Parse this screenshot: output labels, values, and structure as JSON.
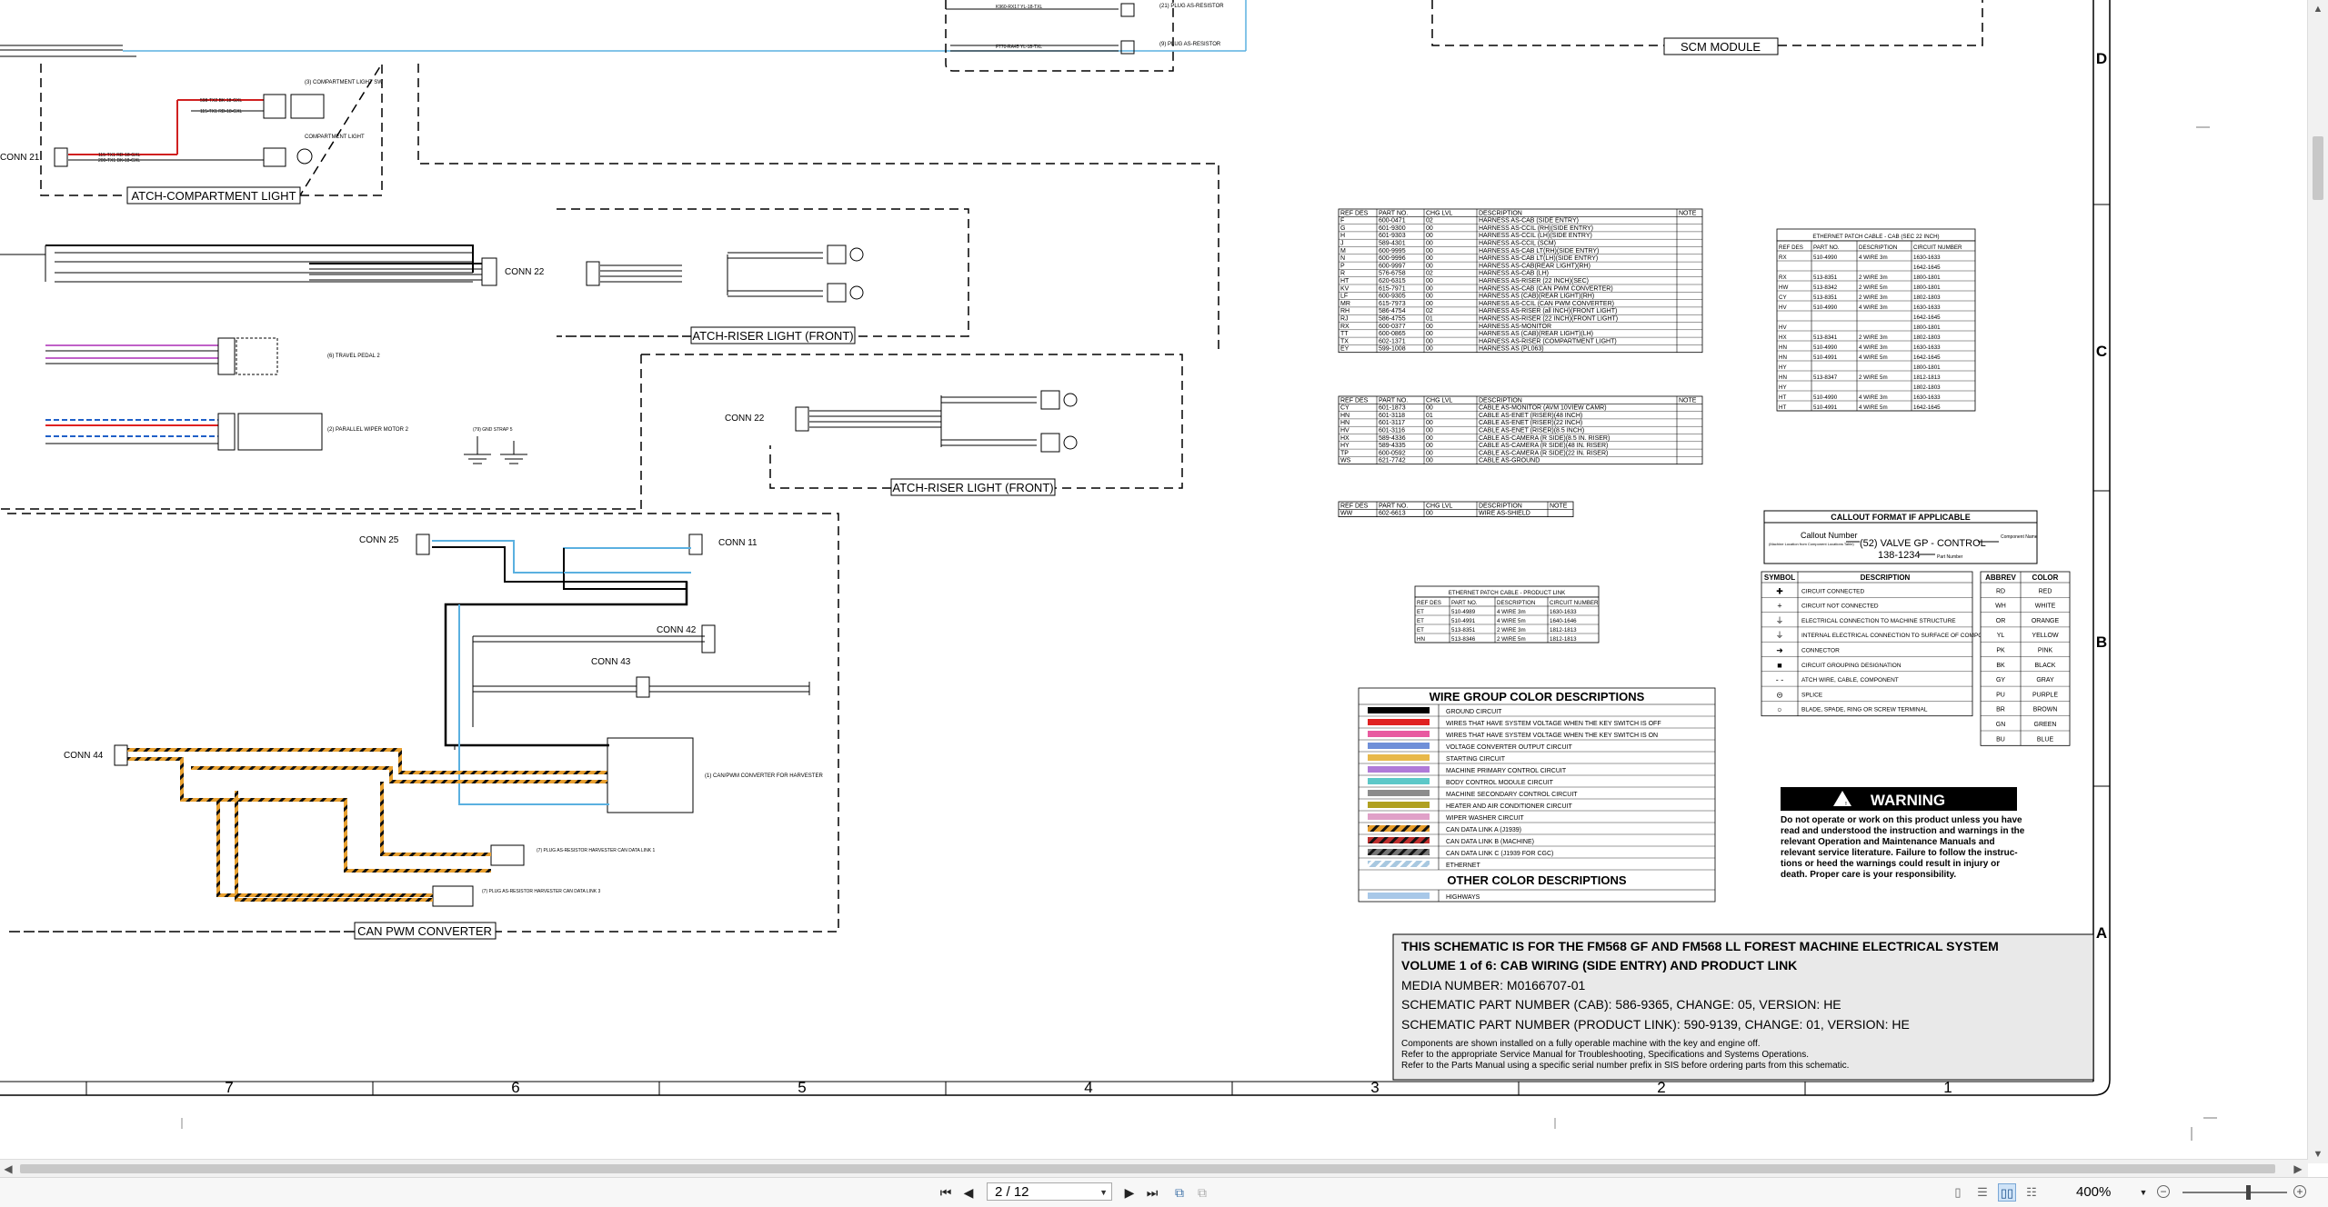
{
  "titleblock": {
    "line1": "THIS SCHEMATIC IS FOR THE FM568 GF AND FM568 LL FOREST MACHINE ELECTRICAL SYSTEM",
    "line2": "VOLUME 1 of 6: CAB WIRING (SIDE ENTRY) AND PRODUCT LINK",
    "line3": "MEDIA NUMBER: M0166707-01",
    "line4": "SCHEMATIC PART NUMBER (CAB): 586-9365, CHANGE: 05, VERSION: HE",
    "line5": "SCHEMATIC PART NUMBER (PRODUCT LINK): 590-9139, CHANGE: 01, VERSION: HE",
    "note1": "Components are shown installed on a fully operable machine with the key and engine off.",
    "note2": "Refer to the appropriate Service Manual for Troubleshooting, Specifications and Systems Operations.",
    "note3": "Refer to the Parts Manual using a specific serial number prefix in SIS before ordering parts from this schematic."
  },
  "modules": {
    "scm": "SCM MODULE",
    "compartment_light": "ATCH-COMPARTMENT LIGHT",
    "riser_front_1": "ATCH-RISER LIGHT (FRONT)",
    "riser_front_2": "ATCH-RISER LIGHT (FRONT)",
    "can_pwm": "CAN PWM CONVERTER"
  },
  "connectors": {
    "conn21": "CONN 21",
    "conn22a": "CONN 22",
    "conn22b": "CONN 22",
    "conn25": "CONN 25",
    "conn11": "CONN 11",
    "conn42": "CONN 42",
    "conn43": "CONN 43",
    "conn44": "CONN 44"
  },
  "components": {
    "travel_pedal": "(6) TRAVEL PEDAL 2",
    "wiper_motor": "(2) PARALLEL WIPER MOTOR 2",
    "gnd_strap": "(79) GND STRAP 5",
    "can_pwm_conv": "(1) CAN/PWM CONVERTER FOR HARVESTER",
    "resistor_1": "(7) PLUG AS-RESISTOR HARVESTER CAN DATA LINK 1",
    "resistor_2": "(7) PLUG AS-RESISTOR HARVESTER CAN DATA LINK 3",
    "compartment_sw": "(3) COMPARTMENT LIGHT SW",
    "compartment_lamp": "COMPARTMENT LIGHT"
  },
  "zones": {
    "bottom": [
      "7",
      "6",
      "5",
      "4",
      "3",
      "2",
      "1"
    ],
    "right": [
      "D",
      "C",
      "B",
      "A"
    ]
  },
  "harness_table1": {
    "headers": [
      "REF DES",
      "PART NO.",
      "CHG LVL",
      "DESCRIPTION",
      "NOTE"
    ],
    "rows": [
      [
        "F",
        "600-0471",
        "02",
        "HARNESS AS-CAB (SIDE ENTRY)",
        ""
      ],
      [
        "G",
        "601-9300",
        "00",
        "HARNESS AS-CCIL (RH)(SIDE ENTRY)",
        ""
      ],
      [
        "H",
        "601-9303",
        "00",
        "HARNESS AS-CCIL (LH)(SIDE ENTRY)",
        ""
      ],
      [
        "J",
        "589-4301",
        "00",
        "HARNESS AS-CCIL (SCM)",
        ""
      ],
      [
        "M",
        "600-9995",
        "00",
        "HARNESS AS-CAB LT(RH)(SIDE ENTRY)",
        ""
      ],
      [
        "N",
        "600-9996",
        "00",
        "HARNESS AS-CAB LT(LH)(SIDE ENTRY)",
        ""
      ],
      [
        "P",
        "600-9997",
        "00",
        "HARNESS AS-CAB(REAR LIGHT)(RH)",
        ""
      ],
      [
        "R",
        "576-6758",
        "02",
        "HARNESS AS-CAB (LH)",
        ""
      ],
      [
        "HT",
        "620-6315",
        "00",
        "HARNESS AS-RISER (22 INCH)(SEC)",
        ""
      ],
      [
        "KV",
        "615-7971",
        "00",
        "HARNESS AS-CAB (CAN PWM CONVERTER)",
        ""
      ],
      [
        "LF",
        "600-9305",
        "00",
        "HARNESS AS (CAB)(REAR LIGHT)(RH)",
        ""
      ],
      [
        "MR",
        "615-7973",
        "00",
        "HARNESS AS-CCIL (CAN PWM CONVERTER)",
        ""
      ],
      [
        "RH",
        "586-4754",
        "02",
        "HARNESS AS-RISER (all INCH)(FRONT LIGHT)",
        ""
      ],
      [
        "RJ",
        "586-4755",
        "01",
        "HARNESS AS-RISER (22 INCH)(FRONT LIGHT)",
        ""
      ],
      [
        "RX",
        "600-0377",
        "00",
        "HARNESS AS-MONITOR",
        ""
      ],
      [
        "TT",
        "600-0865",
        "00",
        "HARNESS AS (CAB)(REAR LIGHT)(LH)",
        ""
      ],
      [
        "TX",
        "602-1371",
        "00",
        "HARNESS AS-RISER (COMPARTMENT LIGHT)",
        ""
      ],
      [
        "EY",
        "599-1008",
        "00",
        "HARNESS AS (PL063)",
        ""
      ]
    ]
  },
  "harness_table2": {
    "headers": [
      "REF DES",
      "PART NO.",
      "CHG LVL",
      "DESCRIPTION",
      "NOTE"
    ],
    "rows": [
      [
        "CY",
        "601-1873",
        "00",
        "CABLE AS-MONITOR (AVM 10VIEW CAMR)",
        ""
      ],
      [
        "HN",
        "601-3118",
        "01",
        "CABLE AS-ENET (RISER)(48 INCH)",
        ""
      ],
      [
        "HN",
        "601-3117",
        "00",
        "CABLE AS-ENET (RISER)(22 INCH)",
        ""
      ],
      [
        "HV",
        "601-3116",
        "00",
        "CABLE AS-ENET (RISER)(8.5 INCH)",
        ""
      ],
      [
        "HX",
        "589-4336",
        "00",
        "CABLE AS-CAMERA (R SIDE)(8.5 IN. RISER)",
        ""
      ],
      [
        "HY",
        "589-4335",
        "00",
        "CABLE AS-CAMERA (R SIDE)(48 IN. RISER)",
        ""
      ],
      [
        "TP",
        "600-0592",
        "00",
        "CABLE AS-CAMERA (R SIDE)(22 IN. RISER)",
        ""
      ],
      [
        "WS",
        "621-7742",
        "00",
        "CABLE AS-GROUND",
        ""
      ]
    ]
  },
  "harness_table3": {
    "headers": [
      "REF DES",
      "PART NO.",
      "CHG LVL",
      "DESCRIPTION",
      "NOTE"
    ],
    "rows": [
      [
        "WW",
        "602-6613",
        "00",
        "WIRE AS-SHIELD",
        ""
      ]
    ]
  },
  "product_link_table": {
    "title": "ETHERNET PATCH CABLE - PRODUCT LINK",
    "headers": [
      "REF DES",
      "PART NO.",
      "DESCRIPTION",
      "CIRCUIT NUMBER"
    ],
    "rows": [
      [
        "ET",
        "510-4989",
        "4 WIRE 3m",
        "1630-1633"
      ],
      [
        "ET",
        "510-4991",
        "4 WIRE 5m",
        "1640-1646"
      ],
      [
        "ET",
        "513-8351",
        "2 WIRE 3m",
        "1812-1813"
      ],
      [
        "HN",
        "513-8346",
        "2 WIRE 5m",
        "1812-1813"
      ]
    ]
  },
  "cab_patch_table": {
    "title": "ETHERNET PATCH CABLE - CAB (SEC 22 INCH)",
    "headers": [
      "REF DES",
      "PART NO.",
      "DESCRIPTION",
      "CIRCUIT NUMBER"
    ],
    "rows": [
      [
        "RX",
        "510-4990",
        "4 WIRE 3m",
        "1630-1633"
      ],
      [
        "",
        "",
        "",
        "1642-1645"
      ],
      [
        "RX",
        "513-8351",
        "2 WIRE 3m",
        "1800-1801"
      ],
      [
        "HW",
        "513-8342",
        "2 WIRE 5m",
        "1800-1801"
      ],
      [
        "CY",
        "513-8351",
        "2 WIRE 3m",
        "1802-1803"
      ],
      [
        "HV",
        "510-4990",
        "4 WIRE 3m",
        "1630-1633"
      ],
      [
        "",
        "",
        "",
        "1642-1645"
      ],
      [
        "HV",
        "",
        "",
        "1800-1801"
      ],
      [
        "HX",
        "513-8341",
        "2 WIRE 3m",
        "1802-1803"
      ],
      [
        "HN",
        "510-4990",
        "4 WIRE 3m",
        "1630-1633"
      ],
      [
        "HN",
        "510-4991",
        "4 WIRE 5m",
        "1642-1645"
      ],
      [
        "HY",
        "",
        "",
        "1800-1801"
      ],
      [
        "HN",
        "513-8347",
        "2 WIRE 5m",
        "1812-1813"
      ],
      [
        "HY",
        "",
        "",
        "1802-1803"
      ],
      [
        "HT",
        "510-4990",
        "4 WIRE 3m",
        "1630-1633"
      ],
      [
        "HT",
        "510-4991",
        "4 WIRE 5m",
        "1642-1645"
      ]
    ]
  },
  "callout": {
    "title": "CALLOUT FORMAT IF APPLICABLE",
    "callout_number": "Callout Number",
    "callout_sub": "(Machine Location from Component Locations Table)",
    "example": "(52) VALVE GP - CONTROL",
    "part": "138-1234",
    "component_name": "Component Name",
    "part_number": "Part Number"
  },
  "symbol_legend": {
    "headers": [
      "SYMBOL",
      "DESCRIPTION"
    ],
    "rows": [
      [
        "CIRCUIT CONNECTED"
      ],
      [
        "CIRCUIT NOT CONNECTED"
      ],
      [
        "ELECTRICAL CONNECTION TO MACHINE STRUCTURE"
      ],
      [
        "INTERNAL ELECTRICAL CONNECTION TO SURFACE OF COMPONENT"
      ],
      [
        "CONNECTOR"
      ],
      [
        "CIRCUIT GROUPING DESIGNATION"
      ],
      [
        "ATCH WIRE, CABLE, COMPONENT"
      ],
      [
        "SPLICE"
      ],
      [
        "BLADE, SPADE, RING OR SCREW TERMINAL"
      ]
    ]
  },
  "color_abbrev": {
    "headers": [
      "ABBREV",
      "COLOR"
    ],
    "rows": [
      [
        "RD",
        "RED"
      ],
      [
        "WH",
        "WHITE"
      ],
      [
        "OR",
        "ORANGE"
      ],
      [
        "YL",
        "YELLOW"
      ],
      [
        "PK",
        "PINK"
      ],
      [
        "BK",
        "BLACK"
      ],
      [
        "GY",
        "GRAY"
      ],
      [
        "PU",
        "PURPLE"
      ],
      [
        "BR",
        "BROWN"
      ],
      [
        "GN",
        "GREEN"
      ],
      [
        "BU",
        "BLUE"
      ]
    ]
  },
  "warning": {
    "title": "WARNING",
    "lines": [
      "Do not operate or work on this product unless you have",
      "read and understood the instruction and warnings in the",
      "relevant Operation and Maintenance Manuals and",
      "relevant service literature. Failure to follow the instruc-",
      "tions or heed the warnings could result in injury or",
      "death. Proper care is your responsibility."
    ]
  },
  "wire_colors": {
    "title": "WIRE GROUP COLOR DESCRIPTIONS",
    "other_title": "OTHER COLOR DESCRIPTIONS",
    "rows": [
      {
        "label": "GROUND CIRCUIT",
        "color": "#000000",
        "pattern": "solid"
      },
      {
        "label": "WIRES THAT HAVE SYSTEM VOLTAGE WHEN THE KEY SWITCH IS OFF",
        "color": "#e02020",
        "pattern": "solid"
      },
      {
        "label": "WIRES THAT HAVE SYSTEM VOLTAGE WHEN THE KEY SWITCH IS ON",
        "color": "#e85aa0",
        "pattern": "solid"
      },
      {
        "label": "VOLTAGE CONVERTER OUTPUT CIRCUIT",
        "color": "#6f8fd8",
        "pattern": "solid"
      },
      {
        "label": "STARTING CIRCUIT",
        "color": "#e8b84a",
        "pattern": "solid"
      },
      {
        "label": "MACHINE PRIMARY CONTROL CIRCUIT",
        "color": "#b07ad8",
        "pattern": "solid"
      },
      {
        "label": "BODY CONTROL MODULE CIRCUIT",
        "color": "#5cc8c8",
        "pattern": "solid"
      },
      {
        "label": "MACHINE SECONDARY CONTROL CIRCUIT",
        "color": "#8c8c8c",
        "pattern": "solid"
      },
      {
        "label": "HEATER AND AIR CONDITIONER CIRCUIT",
        "color": "#b0a020",
        "pattern": "solid"
      },
      {
        "label": "WIPER WASHER CIRCUIT",
        "color": "#e0a0c8",
        "pattern": "solid"
      },
      {
        "label": "CAN DATA LINK A (J1939)",
        "color": "#e0a030",
        "pattern": "hatch"
      },
      {
        "label": "CAN DATA LINK B (MACHINE)",
        "color": "#c03030",
        "pattern": "hatch"
      },
      {
        "label": "CAN DATA LINK C (J1939 FOR CGC)",
        "color": "#303030",
        "pattern": "hatch"
      },
      {
        "label": "ETHERNET",
        "color": "#a8c8e0",
        "pattern": "hatch"
      }
    ],
    "other_rows": [
      {
        "label": "HIGHWAYS",
        "color": "#a8c8e8",
        "pattern": "solid"
      }
    ]
  },
  "viewer": {
    "page_value": "2 / 12",
    "zoom": "400%"
  },
  "colors": {
    "wire_black": "#000000",
    "wire_red": "#d02020",
    "wire_blue": "#5ab0e0",
    "can_orange": "#e8a030",
    "titleblock_bg": "#e9e9e9"
  }
}
